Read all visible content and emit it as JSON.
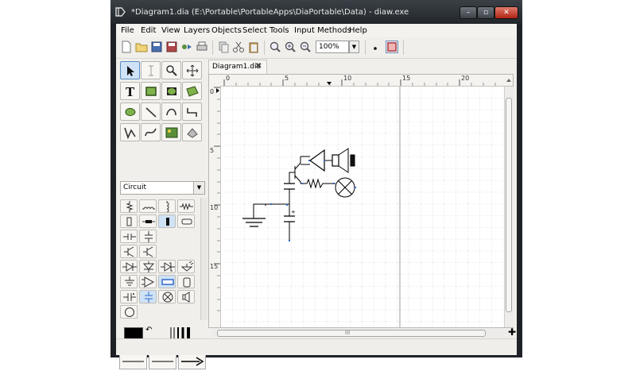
{
  "window": {
    "title": "*Diagram1.dia (E:\\Portable\\PortableApps\\DiaPortable\\Data) - diaw.exe",
    "controls": {
      "minimize": "–",
      "maximize": "▫",
      "close": "✕"
    }
  },
  "menu": [
    "File",
    "Edit",
    "View",
    "Layers",
    "Objects",
    "Select",
    "Tools",
    "Input Methods",
    "Help"
  ],
  "toolbar": {
    "zoom_value": "100%",
    "icons": [
      "new-icon",
      "open-icon",
      "save-icon",
      "save-as-icon",
      "export-icon",
      "print-icon",
      "copy-icon",
      "cut-icon",
      "paste-icon",
      "zoom-fit-icon",
      "zoom-in-icon",
      "zoom-out-icon",
      "snap-grid-icon",
      "object-snapping-icon"
    ]
  },
  "toolbox": {
    "tools": [
      "pointer",
      "text-edit",
      "magnify",
      "scroll",
      "text",
      "box",
      "ellipse",
      "polygon",
      "beziergon",
      "line",
      "arc",
      "zigzagline",
      "polyline",
      "bezierline",
      "image",
      "outline"
    ],
    "sheet": "Circuit"
  },
  "colors": {
    "foreground": "#000000",
    "background": "#ffffff",
    "accent": "#316ac5",
    "titlebar": "#2c3035"
  },
  "document": {
    "tab_label": "Diagram1.dia",
    "tab_close": "✖",
    "ruler_h": [
      "0",
      "5",
      "10",
      "15",
      "20"
    ],
    "ruler_v": [
      "0",
      "5",
      "10",
      "15"
    ]
  },
  "nav_plus": "✚",
  "hscroll_grip": "III"
}
